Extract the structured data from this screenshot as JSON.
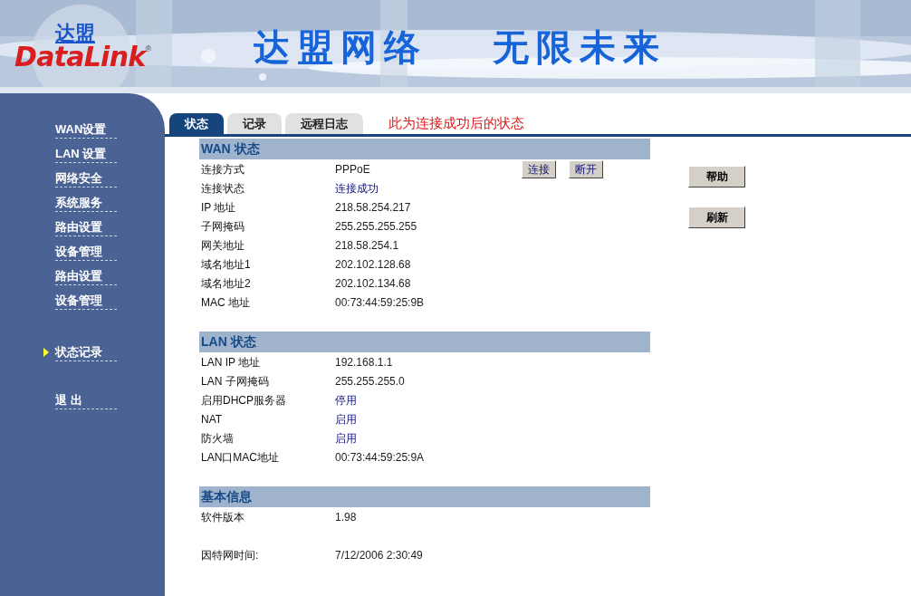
{
  "logo": {
    "cn": "达盟",
    "en": "DataLink",
    "mark": "®"
  },
  "banner": [
    "达盟网络",
    "无限未来"
  ],
  "sidebar": {
    "items": [
      {
        "label": "WAN设置",
        "selected": false
      },
      {
        "label": "LAN 设置",
        "selected": false
      },
      {
        "label": "网络安全",
        "selected": false
      },
      {
        "label": "系统服务",
        "selected": false
      },
      {
        "label": "路由设置",
        "selected": false
      },
      {
        "label": "设备管理",
        "selected": false
      },
      {
        "label": "路由设置",
        "selected": false
      },
      {
        "label": "设备管理",
        "selected": false
      },
      {
        "label": "状态记录",
        "selected": true
      },
      {
        "label": "退 出",
        "selected": false
      }
    ]
  },
  "tabs": [
    {
      "label": "状态",
      "selected": true
    },
    {
      "label": "记录",
      "selected": false
    },
    {
      "label": "远程日志",
      "selected": false
    }
  ],
  "note": "此为连接成功后的状态",
  "sections": [
    {
      "title": "WAN 状态",
      "actions": [
        "连接",
        "断开"
      ],
      "rows": [
        {
          "label": "连接方式",
          "value": "PPPoE",
          "kind": "text"
        },
        {
          "label": "连接状态",
          "value": "连接成功",
          "kind": "status"
        },
        {
          "label": "IP 地址",
          "value": "218.58.254.217",
          "kind": "text"
        },
        {
          "label": "子网掩码",
          "value": "255.255.255.255",
          "kind": "text"
        },
        {
          "label": "网关地址",
          "value": "218.58.254.1",
          "kind": "text"
        },
        {
          "label": "域名地址1",
          "value": "202.102.128.68",
          "kind": "text"
        },
        {
          "label": "域名地址2",
          "value": "202.102.134.68",
          "kind": "text"
        },
        {
          "label": "MAC 地址",
          "value": "00:73:44:59:25:9B",
          "kind": "text"
        }
      ]
    },
    {
      "title": "LAN 状态",
      "rows": [
        {
          "label": "LAN IP 地址",
          "value": "192.168.1.1",
          "kind": "text"
        },
        {
          "label": "LAN 子网掩码",
          "value": "255.255.255.0",
          "kind": "text"
        },
        {
          "label": "启用DHCP服务器",
          "value": "停用",
          "kind": "status"
        },
        {
          "label": "NAT",
          "value": "启用",
          "kind": "status"
        },
        {
          "label": "防火墙",
          "value": "启用",
          "kind": "status"
        },
        {
          "label": "LAN口MAC地址",
          "value": "00:73:44:59:25:9A",
          "kind": "text"
        }
      ]
    },
    {
      "title": "基本信息",
      "rows": [
        {
          "label": "软件版本",
          "value": "1.98",
          "kind": "text"
        },
        {
          "label": "因特网时间:",
          "value": "7/12/2006 2:30:49",
          "kind": "text",
          "gap": true
        }
      ]
    }
  ],
  "side_buttons": [
    "帮助",
    "刷新"
  ]
}
